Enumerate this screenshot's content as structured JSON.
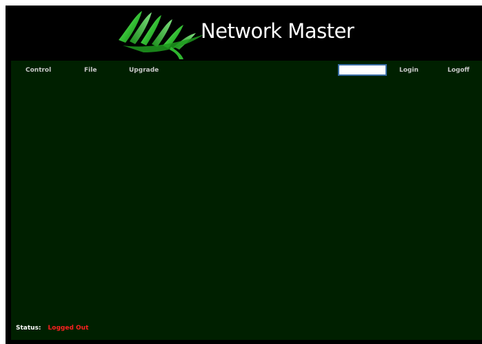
{
  "header": {
    "app_title": "Network Master",
    "logo_icon": "green-ribbon-wave-icon"
  },
  "nav": {
    "control": "Control",
    "file": "File",
    "upgrade": "Upgrade",
    "login": "Login",
    "logoff": "Logoff"
  },
  "login_field": {
    "value": "",
    "placeholder": ""
  },
  "status": {
    "label": "Status:",
    "value": "Logged Out"
  },
  "colors": {
    "page_background": "#000000",
    "panel_background": "#002000",
    "nav_text": "#c8c8c8",
    "status_error": "#ff2020",
    "logo_green": "#3dbf3d"
  }
}
